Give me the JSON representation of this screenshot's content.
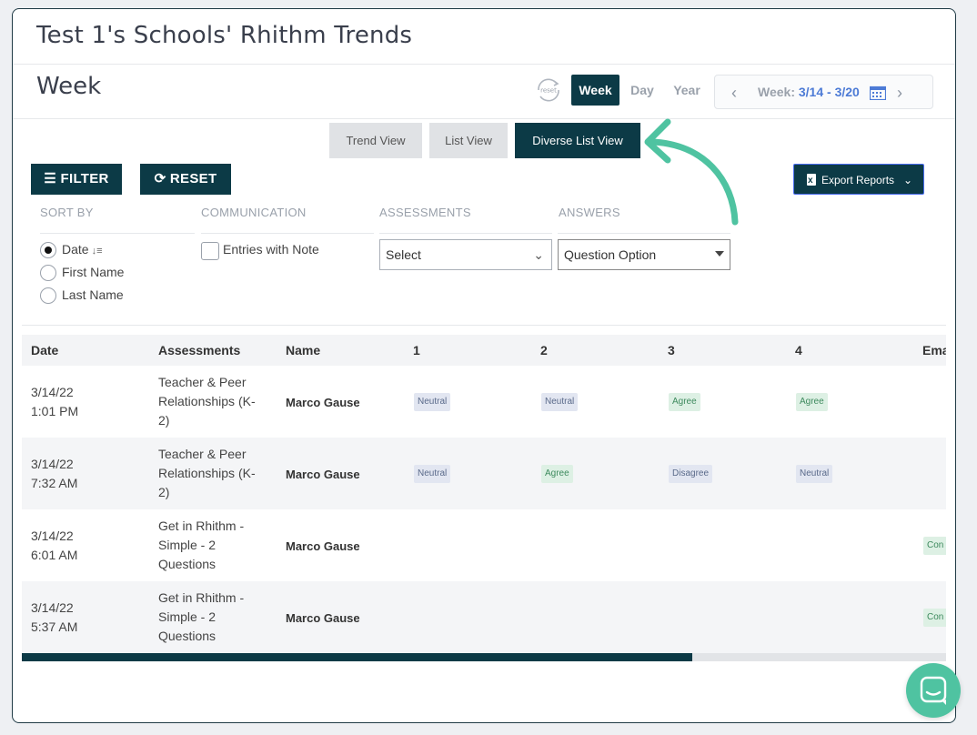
{
  "header": {
    "title": "Test 1's Schools' Rhithm Trends",
    "period": "Week"
  },
  "controls": {
    "reset_icon_text": "reset",
    "ranges": [
      "Week",
      "Day",
      "Year"
    ],
    "week_label": "Week: ",
    "week_range": "3/14 - 3/20"
  },
  "views": [
    "Trend View",
    "List View",
    "Diverse List View"
  ],
  "buttons": {
    "filter": "FILTER",
    "reset": "RESET",
    "export": "Export Reports"
  },
  "filters": {
    "sort_by": "SORT BY",
    "communication": "COMMUNICATION",
    "assessments": "ASSESSMENTS",
    "answers": "ANSWERS",
    "sort_options": [
      "Date",
      "First Name",
      "Last Name"
    ],
    "entries_with_note": "Entries with Note",
    "assessments_value": "Select",
    "answers_value": "Question Option"
  },
  "table": {
    "columns": [
      "Date",
      "Assessments",
      "Name",
      "1",
      "2",
      "3",
      "4",
      "Email"
    ],
    "rows": [
      {
        "date": "3/14/22",
        "time": "1:01 PM",
        "assessment_l1": "Teacher & Peer",
        "assessment_l2": "Relationships (K-",
        "assessment_l3": "2)",
        "name": "Marco Gause",
        "a1": "Neutral",
        "a2": "Neutral",
        "a3": "Agree",
        "a4": "Agree",
        "email": ""
      },
      {
        "date": "3/14/22",
        "time": "7:32 AM",
        "assessment_l1": "Teacher & Peer",
        "assessment_l2": "Relationships (K-",
        "assessment_l3": "2)",
        "name": "Marco Gause",
        "a1": "Neutral",
        "a2": "Agree",
        "a3": "Disagree",
        "a4": "Neutral",
        "email": ""
      },
      {
        "date": "3/14/22",
        "time": "6:01 AM",
        "assessment_l1": "Get in Rhithm -",
        "assessment_l2": "Simple - 2",
        "assessment_l3": "Questions",
        "name": "Marco Gause",
        "a1": "",
        "a2": "",
        "a3": "",
        "a4": "",
        "email": "Con"
      },
      {
        "date": "3/14/22",
        "time": "5:37 AM",
        "assessment_l1": "Get in Rhithm -",
        "assessment_l2": "Simple - 2",
        "assessment_l3": "Questions",
        "name": "Marco Gause",
        "a1": "",
        "a2": "",
        "a3": "",
        "a4": "",
        "email": "Con"
      }
    ]
  },
  "scroll": {
    "position_fraction": 0.725
  },
  "colors": {
    "primary": "#0c3a46",
    "accent": "#4fc3a1",
    "link": "#4d7bd6"
  }
}
